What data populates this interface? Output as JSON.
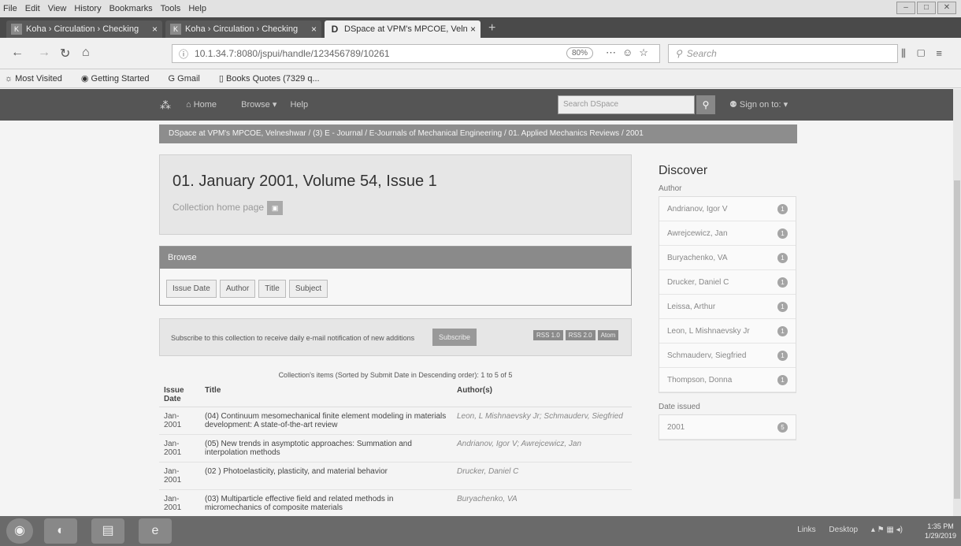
{
  "browser": {
    "menu": [
      "File",
      "Edit",
      "View",
      "History",
      "Bookmarks",
      "Tools",
      "Help"
    ],
    "tabs": [
      {
        "title": "Koha › Circulation › Checking",
        "close": "×"
      },
      {
        "title": "Koha › Circulation › Checking",
        "close": "×"
      },
      {
        "title": "DSpace at VPM's MPCOE, Velne",
        "close": "×"
      }
    ],
    "url": "10.1.34.7:8080/jspui/handle/123456789/10261",
    "zoom": "80%",
    "search_placeholder": "Search",
    "bookmarks": [
      "Most Visited",
      "Getting Started",
      "Gmail",
      "Books Quotes (7329 q..."
    ]
  },
  "dspace_nav": {
    "home": "Home",
    "browse": "Browse ▾",
    "help": "Help",
    "search_placeholder": "Search DSpace",
    "sign_on": "Sign on to: ▾"
  },
  "breadcrumb": "DSpace at VPM's MPCOE, Velneshwar  /  (3) E - Journal  /  E-Journals of Mechanical Engineering  /  01. Applied Mechanics Reviews  /  2001",
  "collection": {
    "title": "01. January 2001, Volume 54, Issue 1",
    "home_page": "Collection home page"
  },
  "browse": {
    "heading": "Browse",
    "buttons": [
      "Issue Date",
      "Author",
      "Title",
      "Subject"
    ]
  },
  "subscribe": {
    "text": "Subscribe to this collection to receive daily e-mail notification of new additions",
    "button": "Subscribe",
    "feeds": [
      "RSS 1.0",
      "RSS 2.0",
      "Atom"
    ]
  },
  "items": {
    "caption": "Collection's items (Sorted by Submit Date in Descending order): 1 to 5 of 5",
    "headers": {
      "date": "Issue Date",
      "title": "Title",
      "authors": "Author(s)"
    },
    "rows": [
      {
        "date": "Jan-2001",
        "title": "(04) Continuum mesomechanical finite element modeling in materials development: A state-of-the-art review",
        "authors": "Leon, L Mishnaevsky Jr; Schmauderv, Siegfried"
      },
      {
        "date": "Jan-2001",
        "title": "(05) New trends in asymptotic approaches: Summation and interpolation methods",
        "authors": "Andrianov, Igor V; Awrejcewicz, Jan"
      },
      {
        "date": "Jan-2001",
        "title": "(02 ) Photoelasticity, plasticity, and material behavior",
        "authors": "Drucker, Daniel C"
      },
      {
        "date": "Jan-2001",
        "title": "(03) Multiparticle effective field and related methods in micromechanics of composite materials",
        "authors": "Buryachenko, VA"
      }
    ]
  },
  "discover": {
    "heading": "Discover",
    "author_label": "Author",
    "authors": [
      {
        "name": "Andrianov, Igor V",
        "count": "1"
      },
      {
        "name": "Awrejcewicz, Jan",
        "count": "1"
      },
      {
        "name": "Buryachenko, VA",
        "count": "1"
      },
      {
        "name": "Drucker, Daniel C",
        "count": "1"
      },
      {
        "name": "Leissa, Arthur",
        "count": "1"
      },
      {
        "name": "Leon, L Mishnaevsky Jr",
        "count": "1"
      },
      {
        "name": "Schmauderv, Siegfried",
        "count": "1"
      },
      {
        "name": "Thompson, Donna",
        "count": "1"
      }
    ],
    "date_label": "Date issued",
    "dates": [
      {
        "year": "2001",
        "count": "5"
      }
    ]
  },
  "taskbar": {
    "links": "Links",
    "desktop": "Desktop",
    "time": "1:35 PM",
    "date": "1/29/2019"
  }
}
